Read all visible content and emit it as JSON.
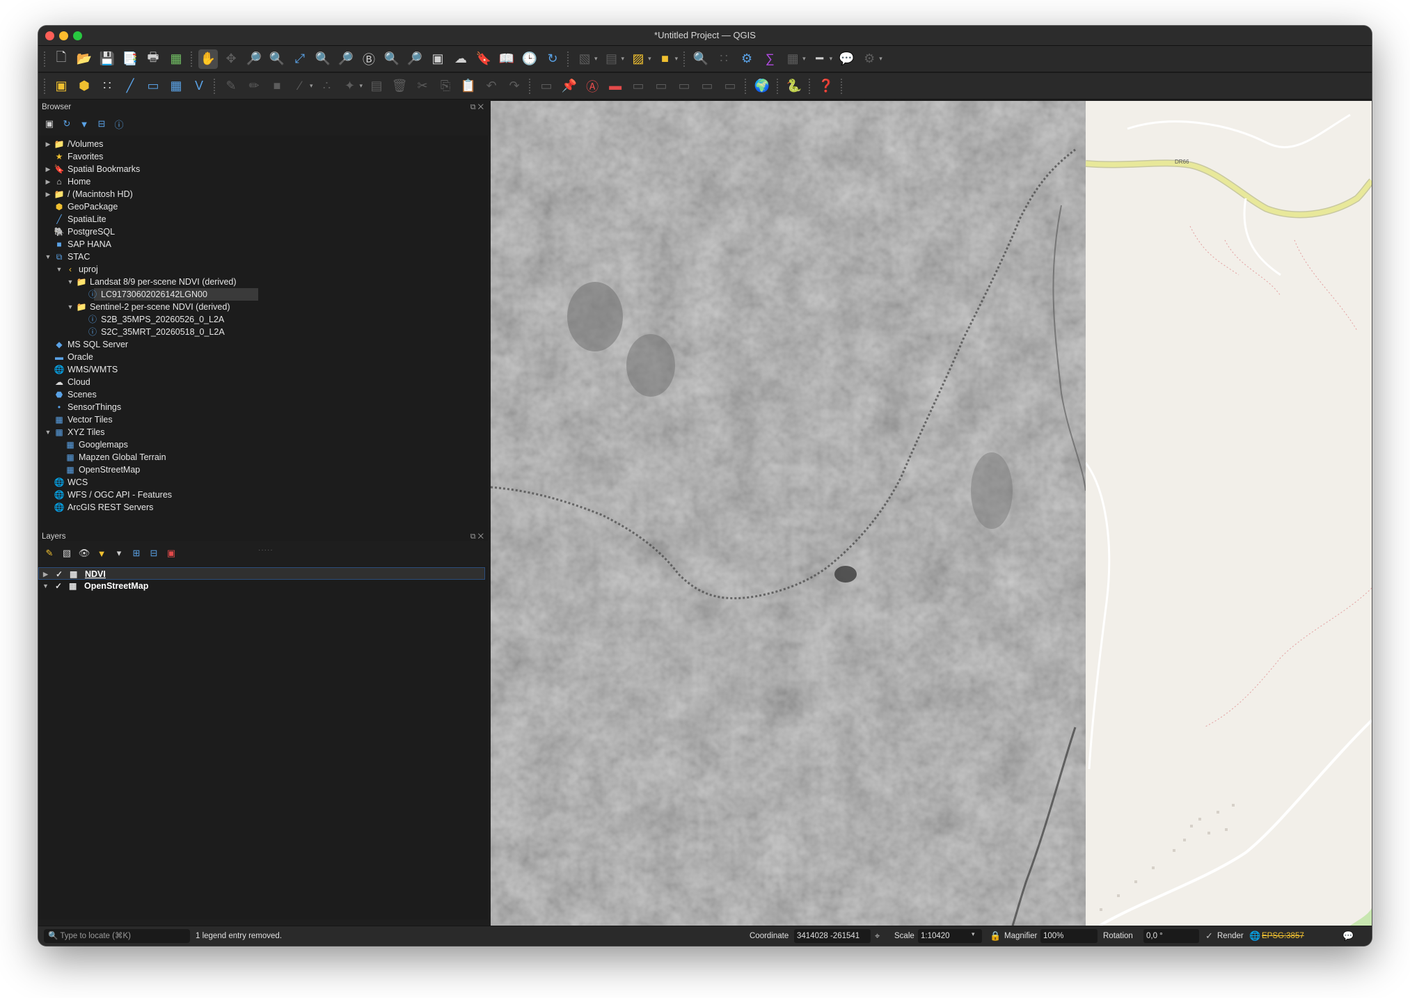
{
  "window": {
    "title": "*Untitled Project — QGIS"
  },
  "toolbar1": {
    "icons": [
      "new-project-icon",
      "open-project-icon",
      "save-project-icon",
      "save-as-icon",
      "print-layout-icon",
      "style-manager-icon",
      "pan-icon",
      "pan-to-selection-icon",
      "zoom-in-icon",
      "zoom-out-icon",
      "zoom-full-icon",
      "zoom-selection-icon",
      "zoom-layer-icon",
      "zoom-native-icon",
      "zoom-last-icon",
      "zoom-next-icon",
      "new-map-view-icon",
      "new-3d-view-icon",
      "new-bookmark-icon",
      "show-bookmarks-icon",
      "temporal-controller-icon",
      "refresh-icon",
      "identify-features-icon",
      "select-features-icon",
      "deselect-icon",
      "select-by-value-icon",
      "attribute-table-icon",
      "field-calculator-icon",
      "statistical-summary-icon",
      "measure-icon",
      "map-tips-icon",
      "settings-gear-icon"
    ]
  },
  "toolbar2": {
    "icons": [
      "data-source-manager-icon",
      "new-geopackage-icon",
      "new-shapefile-icon",
      "new-spatialite-icon",
      "new-virtual-layer-icon",
      "add-raster-icon",
      "add-vector-icon",
      "current-edits-icon",
      "toggle-editing-icon",
      "save-edits-icon",
      "digitize-icon",
      "vertex-tool-icon",
      "modify-attributes-icon",
      "delete-selected-icon",
      "cut-features-icon",
      "copy-features-icon",
      "paste-features-icon",
      "undo-icon",
      "redo-icon",
      "label-icon",
      "pin-labels-icon",
      "highlight-labels-icon",
      "label-abc-icon",
      "move-label-icon",
      "rotate-label-icon",
      "change-label-icon",
      "rule-label-icon",
      "diagram-icon",
      "globe-icon",
      "python-console-icon",
      "help-icon"
    ]
  },
  "browser": {
    "title": "Browser",
    "items": [
      {
        "label": "/Volumes",
        "icon": "folder-icon",
        "expanded": false,
        "depth": 0,
        "has_arrow": true
      },
      {
        "label": "Favorites",
        "icon": "star-icon",
        "expanded": false,
        "depth": 0,
        "has_arrow": false
      },
      {
        "label": "Spatial Bookmarks",
        "icon": "bookmark-icon",
        "expanded": false,
        "depth": 0,
        "has_arrow": true
      },
      {
        "label": "Home",
        "icon": "home-icon",
        "expanded": false,
        "depth": 0,
        "has_arrow": true
      },
      {
        "label": "/ (Macintosh HD)",
        "icon": "folder-icon",
        "expanded": false,
        "depth": 0,
        "has_arrow": true
      },
      {
        "label": "GeoPackage",
        "icon": "geopackage-icon",
        "expanded": false,
        "depth": 0,
        "has_arrow": false
      },
      {
        "label": "SpatiaLite",
        "icon": "spatialite-icon",
        "expanded": false,
        "depth": 0,
        "has_arrow": false
      },
      {
        "label": "PostgreSQL",
        "icon": "postgresql-icon",
        "expanded": false,
        "depth": 0,
        "has_arrow": false
      },
      {
        "label": "SAP HANA",
        "icon": "sap-hana-icon",
        "expanded": false,
        "depth": 0,
        "has_arrow": false
      },
      {
        "label": "STAC",
        "icon": "stac-icon",
        "expanded": true,
        "depth": 0,
        "has_arrow": true
      },
      {
        "label": "uproj",
        "icon": "stac-connection-icon",
        "expanded": true,
        "depth": 1,
        "has_arrow": true
      },
      {
        "label": "Landsat 8/9 per-scene NDVI (derived)",
        "icon": "collection-icon",
        "expanded": true,
        "depth": 2,
        "has_arrow": true
      },
      {
        "label": "LC91730602026142LGN00",
        "icon": "item-icon",
        "expanded": false,
        "depth": 3,
        "has_arrow": false,
        "selected": true
      },
      {
        "label": "Sentinel-2 per-scene NDVI (derived)",
        "icon": "collection-icon",
        "expanded": true,
        "depth": 2,
        "has_arrow": true
      },
      {
        "label": "S2B_35MPS_20260526_0_L2A",
        "icon": "item-icon",
        "expanded": false,
        "depth": 3,
        "has_arrow": false
      },
      {
        "label": "S2C_35MRT_20260518_0_L2A",
        "icon": "item-icon",
        "expanded": false,
        "depth": 3,
        "has_arrow": false
      },
      {
        "label": "MS SQL Server",
        "icon": "mssql-icon",
        "expanded": false,
        "depth": 0,
        "has_arrow": false
      },
      {
        "label": "Oracle",
        "icon": "oracle-icon",
        "expanded": false,
        "depth": 0,
        "has_arrow": false
      },
      {
        "label": "WMS/WMTS",
        "icon": "wms-icon",
        "expanded": false,
        "depth": 0,
        "has_arrow": false
      },
      {
        "label": "Cloud",
        "icon": "cloud-icon",
        "expanded": false,
        "depth": 0,
        "has_arrow": false
      },
      {
        "label": "Scenes",
        "icon": "scenes-icon",
        "expanded": false,
        "depth": 0,
        "has_arrow": false
      },
      {
        "label": "SensorThings",
        "icon": "sensorthings-icon",
        "expanded": false,
        "depth": 0,
        "has_arrow": false
      },
      {
        "label": "Vector Tiles",
        "icon": "vector-tiles-icon",
        "expanded": false,
        "depth": 0,
        "has_arrow": false
      },
      {
        "label": "XYZ Tiles",
        "icon": "xyz-tiles-icon",
        "expanded": true,
        "depth": 0,
        "has_arrow": true
      },
      {
        "label": "Googlemaps",
        "icon": "xyz-tiles-icon",
        "expanded": false,
        "depth": 1,
        "has_arrow": false
      },
      {
        "label": "Mapzen Global Terrain",
        "icon": "xyz-tiles-icon",
        "expanded": false,
        "depth": 1,
        "has_arrow": false
      },
      {
        "label": "OpenStreetMap",
        "icon": "xyz-tiles-icon",
        "expanded": false,
        "depth": 1,
        "has_arrow": false
      },
      {
        "label": "WCS",
        "icon": "wcs-icon",
        "expanded": false,
        "depth": 0,
        "has_arrow": false
      },
      {
        "label": "WFS / OGC API - Features",
        "icon": "wfs-icon",
        "expanded": false,
        "depth": 0,
        "has_arrow": false
      },
      {
        "label": "ArcGIS REST Servers",
        "icon": "arcgis-icon",
        "expanded": false,
        "depth": 0,
        "has_arrow": false
      }
    ]
  },
  "layers": {
    "title": "Layers",
    "items": [
      {
        "label": "NDVI",
        "checked": true,
        "expanded": false,
        "selected": true
      },
      {
        "label": "OpenStreetMap",
        "checked": true,
        "expanded": true,
        "selected": false
      }
    ]
  },
  "map": {
    "road_label": "DR66",
    "ndvi_color": "#8c8c8c",
    "osm_bg_color": "#f2efe9",
    "road_color": "#e8e89a"
  },
  "status": {
    "locator_placeholder": "Type to locate (⌘K)",
    "message": "1 legend entry removed.",
    "coordinate_label": "Coordinate",
    "coordinate_value": "3414028  -261541",
    "scale_label": "Scale",
    "scale_value": "1:10420",
    "magnifier_label": "Magnifier",
    "magnifier_value": "100%",
    "rotation_label": "Rotation",
    "rotation_value": "0,0 °",
    "render_label": "Render",
    "render_checked": true,
    "crs": "EPSG:3857"
  }
}
